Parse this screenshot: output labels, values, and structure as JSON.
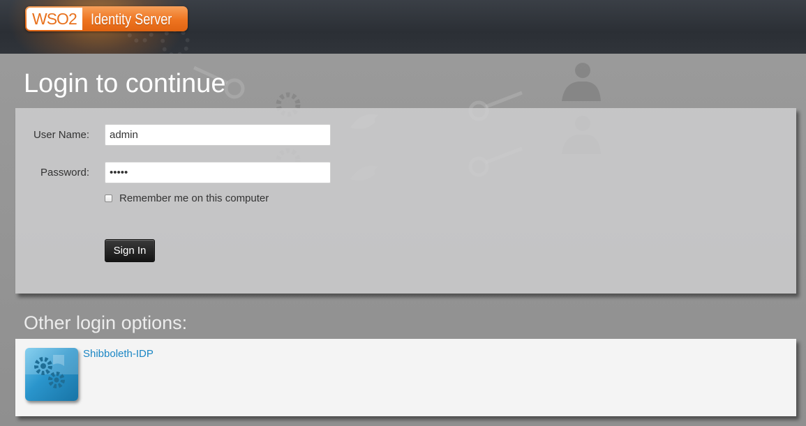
{
  "header": {
    "logo_wso2": "WSO2",
    "logo_product": "Identity Server"
  },
  "page": {
    "title": "Login to continue"
  },
  "login_form": {
    "username_label": "User Name:",
    "username_value": "admin",
    "password_label": "Password:",
    "password_value": "admin",
    "remember_label": "Remember me on this computer",
    "remember_checked": false,
    "signin_label": "Sign In"
  },
  "other_options": {
    "title": "Other login options:",
    "providers": [
      {
        "label": "Shibboleth-IDP",
        "icon": "gears-icon"
      }
    ]
  },
  "colors": {
    "brand_orange": "#ee7420",
    "link_blue": "#1a86c4",
    "button_dark": "#141414"
  }
}
